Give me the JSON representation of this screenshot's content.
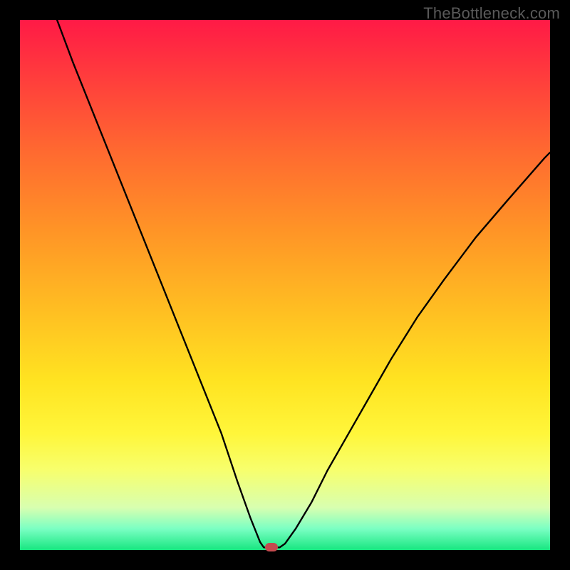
{
  "watermark": "TheBottleneck.com",
  "chart_data": {
    "type": "line",
    "title": "",
    "xlabel": "",
    "ylabel": "",
    "xlim": [
      0,
      100
    ],
    "ylim": [
      0,
      100
    ],
    "series": [
      {
        "name": "left-branch",
        "x": [
          7,
          10,
          14,
          18,
          22,
          26,
          30,
          34,
          38,
          41,
          43.5,
          45.3,
          46
        ],
        "y": [
          100,
          92,
          82,
          72,
          62,
          52,
          42,
          32,
          22,
          13,
          6,
          1.5,
          0.5
        ]
      },
      {
        "name": "right-branch",
        "x": [
          49,
          50,
          52,
          55,
          58,
          62,
          66,
          70,
          75,
          80,
          86,
          92,
          99,
          100
        ],
        "y": [
          0.5,
          1.2,
          4,
          9,
          15,
          22,
          29,
          36,
          44,
          51,
          59,
          66,
          74,
          75
        ]
      }
    ],
    "flat_bottom": {
      "x": [
        46,
        49
      ],
      "y": 0.5
    },
    "marker": {
      "x": 47.5,
      "y": 0.5,
      "color": "#c54a4e"
    },
    "background_gradient": {
      "top": "#ff1a46",
      "bottom": "#17e680"
    }
  }
}
